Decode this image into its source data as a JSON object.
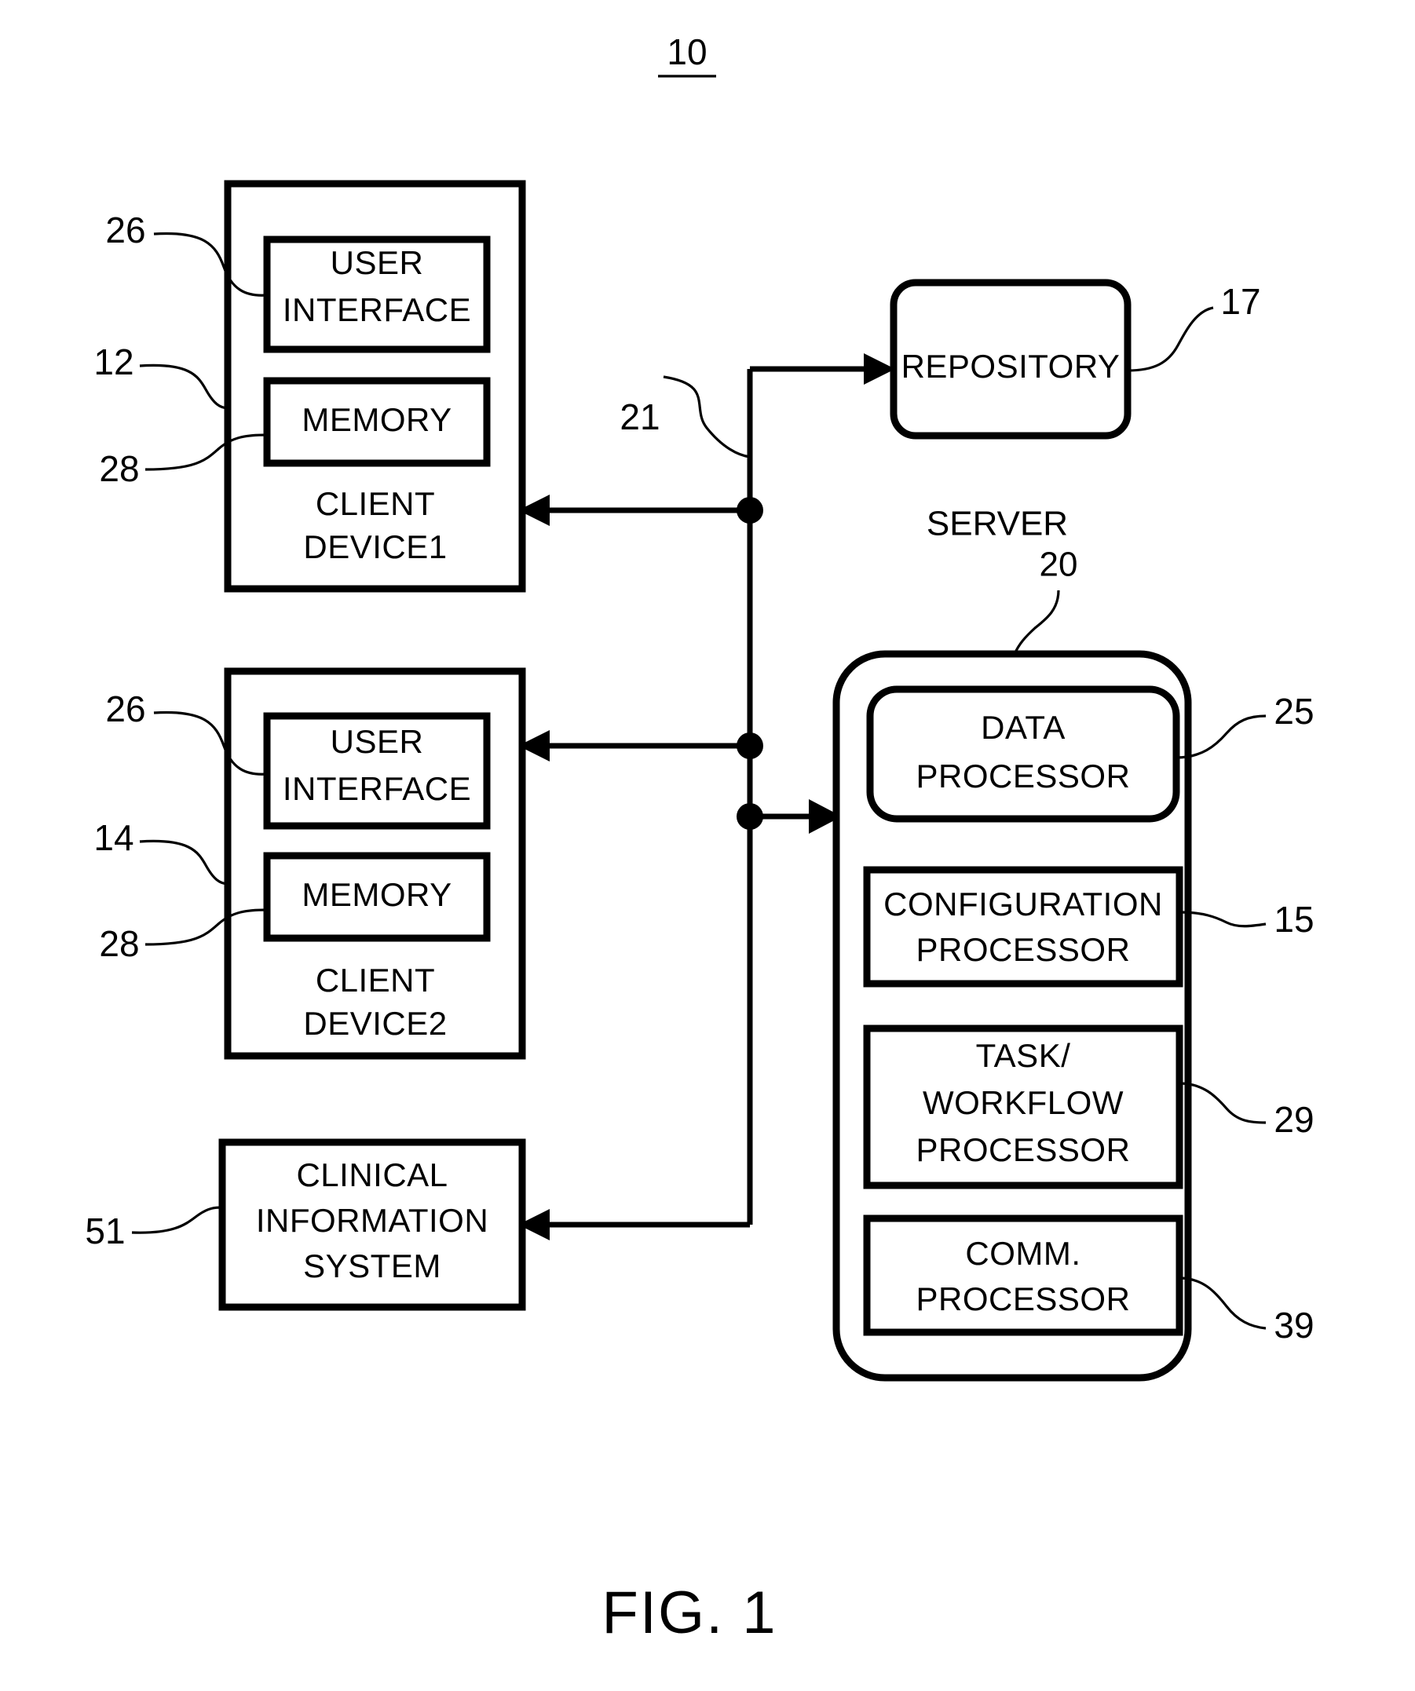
{
  "figure": {
    "system_number": "10",
    "caption": "FIG. 1"
  },
  "blocks": {
    "client1": {
      "title_line1": "CLIENT",
      "title_line2": "DEVICE1",
      "ref": "12",
      "user_interface": {
        "line1": "USER",
        "line2": "INTERFACE",
        "ref": "26"
      },
      "memory": {
        "label": "MEMORY",
        "ref": "28"
      }
    },
    "client2": {
      "title_line1": "CLIENT",
      "title_line2": "DEVICE2",
      "ref": "14",
      "user_interface": {
        "line1": "USER",
        "line2": "INTERFACE",
        "ref": "26"
      },
      "memory": {
        "label": "MEMORY",
        "ref": "28"
      }
    },
    "repository": {
      "label": "REPOSITORY",
      "ref": "17"
    },
    "clinical_information_system": {
      "line1": "CLINICAL",
      "line2": "INFORMATION",
      "line3": "SYSTEM",
      "ref": "51"
    },
    "server": {
      "title": "SERVER",
      "ref": "20",
      "modules": [
        {
          "line1": "DATA",
          "line2": "PROCESSOR",
          "ref": "25"
        },
        {
          "line1": "CONFIGURATION",
          "line2": "PROCESSOR",
          "ref": "15"
        },
        {
          "line1": "TASK/",
          "line2": "WORKFLOW",
          "line3": "PROCESSOR",
          "ref": "29"
        },
        {
          "line1": "COMM.",
          "line2": "PROCESSOR",
          "ref": "39"
        }
      ]
    }
  },
  "network": {
    "bus_ref": "21"
  }
}
